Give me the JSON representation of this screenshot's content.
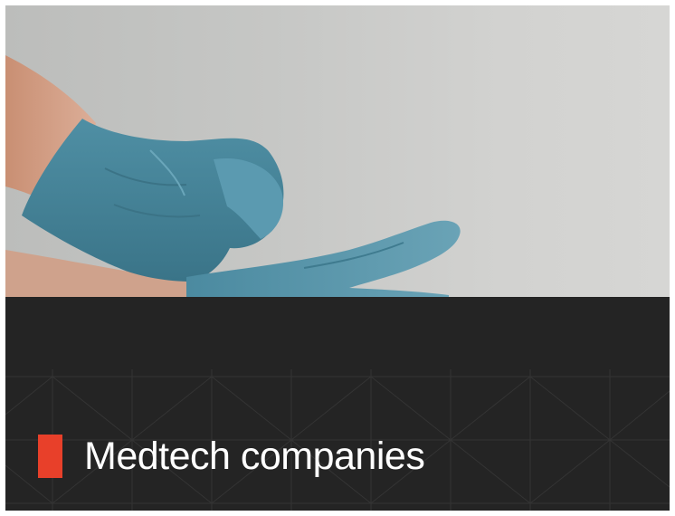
{
  "card": {
    "title": "Medtech companies",
    "accent_color": "#e8402a",
    "background_color": "#242424",
    "image": {
      "subject": "gloved-hand-photo"
    }
  }
}
